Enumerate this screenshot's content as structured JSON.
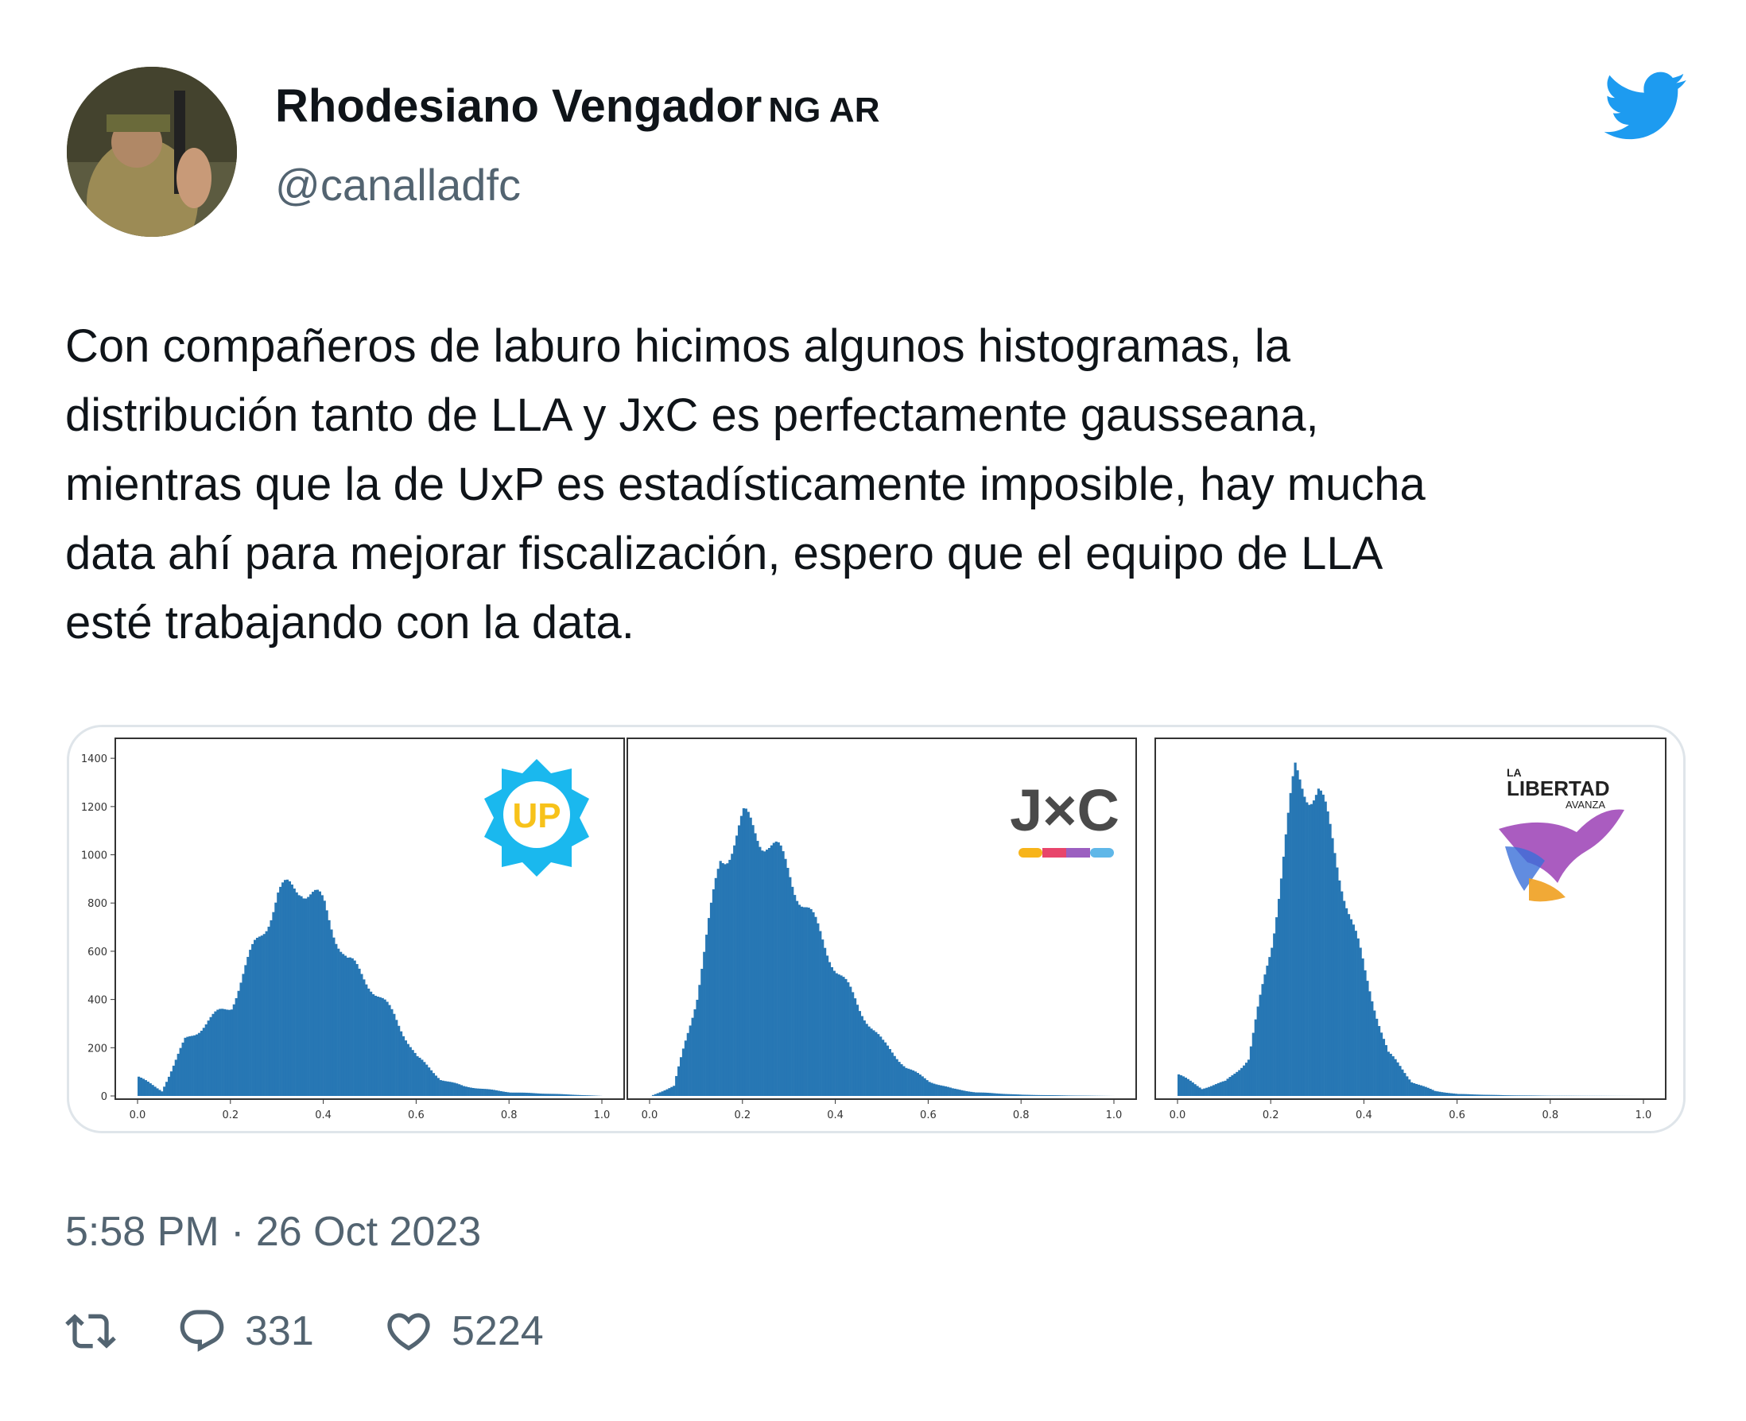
{
  "user": {
    "display_name": "Rhodesiano Vengador",
    "flag_text": "NG AR",
    "handle": "@canalladfc"
  },
  "tweet": {
    "text": "Con compañeros de laburo hicimos algunos histogramas, la\ndistribución tanto de LLA y JxC es perfectamente gausseana,\nmientras que la de UxP es estadísticamente imposible, hay mucha\ndata ahí para mejorar fiscalización, espero que el equipo de LLA\nesté trabajando con la data.",
    "timestamp": "5:58 PM · 26 Oct 2023"
  },
  "stats": {
    "replies": "331",
    "likes": "5224"
  },
  "colors": {
    "bar": "#2777b4",
    "twitter_blue": "#1d9bf0",
    "muted": "#536471",
    "up_logo": "#1ab8ee",
    "up_text": "#f7c21a"
  },
  "icons": [
    "avatar-photo",
    "twitter-bird-icon",
    "retweet-icon",
    "reply-icon",
    "like-icon",
    "up-logo",
    "jxc-logo",
    "lla-logo"
  ],
  "media": {
    "logos": {
      "up": "UP",
      "jxc": "J×C",
      "lla_small": "LA",
      "lla_main": "LIBERTAD",
      "lla_sub": "AVANZA"
    }
  },
  "chart_data": [
    {
      "type": "bar",
      "series_name": "",
      "x_ticks": [
        "0.0",
        "0.2",
        "0.4",
        "0.6",
        "0.8",
        "1.0"
      ],
      "y_ticks": [
        "0",
        "200",
        "400",
        "600",
        "800",
        "1000",
        "1200",
        "1400"
      ],
      "xlim": [
        0,
        1
      ],
      "ylim": [
        0,
        1450
      ],
      "x": [
        0.0,
        0.05,
        0.1,
        0.15,
        0.2,
        0.25,
        0.3,
        0.35,
        0.4,
        0.45,
        0.5,
        0.55,
        0.6,
        0.65,
        0.7,
        0.8,
        0.9,
        1.0
      ],
      "values": [
        80,
        20,
        230,
        310,
        380,
        620,
        830,
        880,
        780,
        560,
        460,
        330,
        160,
        70,
        40,
        15,
        8,
        0
      ]
    },
    {
      "type": "bar",
      "series_name": "",
      "x_ticks": [
        "0.0",
        "0.2",
        "0.4",
        "0.6",
        "0.8",
        "1.0"
      ],
      "y_ticks": [],
      "xlim": [
        0,
        1
      ],
      "ylim": [
        0,
        1450
      ],
      "x": [
        0.0,
        0.05,
        0.1,
        0.15,
        0.2,
        0.25,
        0.3,
        0.35,
        0.4,
        0.45,
        0.5,
        0.55,
        0.6,
        0.65,
        0.7,
        0.8,
        0.9,
        1.0
      ],
      "values": [
        0,
        40,
        420,
        980,
        1130,
        1070,
        920,
        720,
        530,
        360,
        220,
        120,
        60,
        30,
        15,
        5,
        2,
        0
      ]
    },
    {
      "type": "bar",
      "series_name": "",
      "x_ticks": [
        "0.0",
        "0.2",
        "0.4",
        "0.6",
        "0.8",
        "1.0"
      ],
      "y_ticks": [],
      "xlim": [
        0,
        1
      ],
      "ylim": [
        0,
        1450
      ],
      "x": [
        0.0,
        0.05,
        0.1,
        0.15,
        0.2,
        0.25,
        0.3,
        0.35,
        0.4,
        0.45,
        0.5,
        0.55,
        0.6,
        0.7,
        0.8,
        1.0
      ],
      "values": [
        90,
        30,
        60,
        150,
        650,
        1320,
        1260,
        900,
        500,
        180,
        60,
        20,
        8,
        3,
        1,
        0
      ]
    }
  ]
}
